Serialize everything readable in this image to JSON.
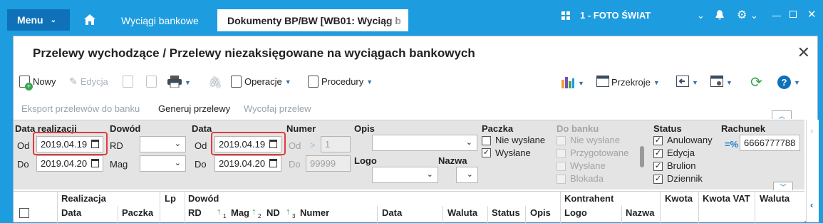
{
  "topbar": {
    "menu_label": "Menu",
    "tabs": [
      "Wyciągi bankowe",
      "Dokumenty BP/BW [WB01: Wyciąg b"
    ],
    "company": "1 - FOTO ŚWIAT"
  },
  "window": {
    "title": "Przelewy wychodzące / Przelewy niezaksięgowane na wyciągach bankowych"
  },
  "toolbar": {
    "new_label": "Nowy",
    "edit_label": "Edycja",
    "operations_label": "Operacje",
    "procedures_label": "Procedury",
    "crosssections_label": "Przekroje"
  },
  "actions": {
    "export_label": "Eksport przelewów do banku",
    "generate_label": "Generuj przelewy",
    "withdraw_label": "Wycofaj przelew"
  },
  "filters": {
    "realization": {
      "title": "Data realizacji",
      "from_label": "Od",
      "from": "2019.04.19",
      "to_label": "Do",
      "to": "2019.04.20"
    },
    "document": {
      "title": "Dowód",
      "rd_label": "RD",
      "mag_label": "Mag"
    },
    "date": {
      "title": "Data",
      "from_label": "Od",
      "from": "2019.04.19",
      "to_label": "Do",
      "to": "2019.04.20"
    },
    "number": {
      "title": "Numer",
      "from_label": "Od",
      "from": "1",
      "to_label": "Do",
      "to": "99999"
    },
    "description": {
      "title": "Opis",
      "logo_label": "Logo",
      "name_label": "Nazwa"
    },
    "package": {
      "title": "Paczka",
      "not_sent": "Nie wysłane",
      "sent": "Wysłane"
    },
    "to_bank": {
      "title": "Do banku",
      "items": [
        "Nie wysłane",
        "Przygotowane",
        "Wysłane",
        "Blokada"
      ]
    },
    "status": {
      "title": "Status",
      "items": [
        "Anulowany",
        "Edycja",
        "Brulion",
        "Dziennik"
      ]
    },
    "account": {
      "title": "Rachunek",
      "prefix": "=%",
      "value": "6666777788"
    }
  },
  "grid": {
    "group_headers": [
      "Realizacja",
      "Lp",
      "Dowód",
      "Kontrahent",
      "Kwota",
      "Kwota VAT",
      "Waluta"
    ],
    "columns": [
      "Data",
      "Paczka",
      "RD",
      "Mag",
      "ND",
      "Numer",
      "Data",
      "Waluta",
      "Status",
      "Opis",
      "Logo",
      "Nazwa"
    ],
    "sort_markers": [
      "1",
      "2",
      "3"
    ]
  }
}
